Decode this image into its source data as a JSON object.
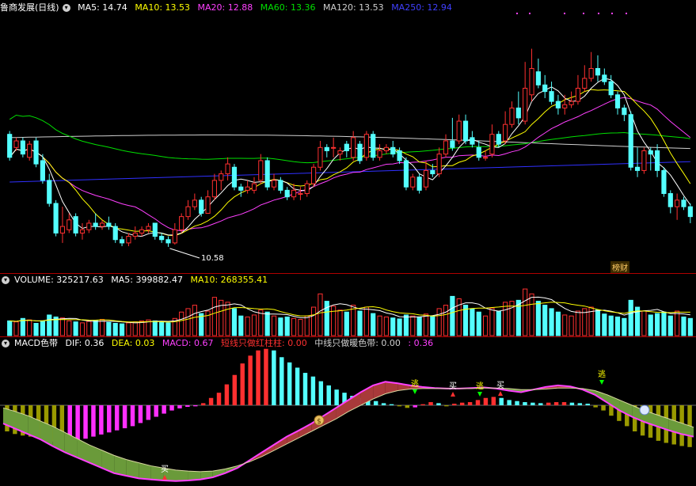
{
  "colors": {
    "up": "#ff3030",
    "down": "#54ffff",
    "ma5": "#ffffff",
    "ma10": "#ffff00",
    "ma20": "#ff40ff",
    "ma60": "#00e000",
    "ma120": "#d0d0d0",
    "ma250": "#3030ff",
    "bg": "#000000",
    "sep": "#b00000"
  },
  "price_panel": {
    "title": "鲁商发展(日线)",
    "collapse_icon": "chevron-down-icon",
    "ma5": "MA5: 14.74",
    "ma10": "MA10: 13.53",
    "ma20": "MA20: 12.88",
    "ma60": "MA60: 13.36",
    "ma120": "MA120: 13.53",
    "ma250": "MA250: 12.94",
    "min_label": "10.58",
    "badge": "榜财"
  },
  "volume_panel": {
    "volume": "VOLUME: 325217.63",
    "ma5": "MA5: 399882.47",
    "ma10": "MA10: 268355.41"
  },
  "macd_panel": {
    "title": "MACD色带",
    "dif": "DIF: 0.36",
    "dea": "DEA: 0.03",
    "macd": "MACD: 0.67",
    "red_bar": "短线只做红柱柱: 0.00",
    "warm_band": "中线只做暖色带: 0.00",
    "extra": ": 0.36",
    "signal_buy": "买",
    "signal_escape": "逃",
    "dollar": "$"
  },
  "chart_data": {
    "type": "candlestick",
    "ylim": [
      10.0,
      17.6
    ],
    "candles": [
      [
        14.0,
        13.3,
        14.1,
        13.2
      ],
      [
        13.6,
        13.8,
        13.9,
        13.5
      ],
      [
        13.8,
        13.4,
        13.9,
        13.3
      ],
      [
        13.3,
        13.7,
        13.8,
        13.2
      ],
      [
        13.8,
        13.1,
        13.9,
        13.0
      ],
      [
        13.2,
        12.6,
        13.4,
        12.5
      ],
      [
        12.6,
        11.9,
        12.8,
        11.8
      ],
      [
        11.9,
        11.0,
        12.0,
        10.9
      ],
      [
        11.0,
        11.2,
        11.8,
        10.7
      ],
      [
        11.1,
        11.4,
        11.6,
        11.0
      ],
      [
        11.5,
        11.0,
        11.6,
        10.9
      ],
      [
        11.0,
        11.1,
        11.3,
        10.8
      ],
      [
        11.1,
        11.3,
        11.4,
        11.0
      ],
      [
        11.3,
        11.2,
        11.6,
        11.1
      ],
      [
        11.2,
        11.3,
        11.4,
        11.1
      ],
      [
        11.3,
        11.2,
        11.5,
        11.1
      ],
      [
        11.2,
        10.8,
        11.3,
        10.7
      ],
      [
        10.8,
        10.7,
        10.9,
        10.6
      ],
      [
        10.7,
        10.9,
        11.0,
        10.6
      ],
      [
        10.9,
        11.0,
        11.2,
        10.8
      ],
      [
        11.0,
        11.1,
        11.2,
        10.9
      ],
      [
        11.1,
        11.2,
        11.3,
        11.0
      ],
      [
        11.3,
        10.9,
        11.3,
        10.8
      ],
      [
        10.9,
        10.8,
        11.0,
        10.7
      ],
      [
        10.8,
        10.7,
        10.9,
        10.58
      ],
      [
        10.7,
        11.1,
        11.3,
        10.65
      ],
      [
        11.1,
        11.5,
        11.6,
        11.0
      ],
      [
        11.5,
        11.8,
        12.0,
        11.4
      ],
      [
        11.8,
        12.0,
        12.2,
        11.7
      ],
      [
        12.0,
        11.6,
        12.1,
        11.5
      ],
      [
        11.6,
        12.1,
        12.3,
        11.6
      ],
      [
        12.1,
        12.6,
        12.8,
        12.0
      ],
      [
        12.6,
        12.8,
        12.9,
        12.3
      ],
      [
        12.8,
        13.1,
        13.3,
        12.6
      ],
      [
        13.0,
        12.4,
        13.1,
        12.3
      ],
      [
        12.4,
        12.3,
        12.5,
        12.1
      ],
      [
        12.3,
        12.4,
        12.6,
        12.2
      ],
      [
        12.3,
        12.5,
        12.7,
        12.2
      ],
      [
        12.6,
        13.2,
        13.4,
        12.5
      ],
      [
        13.2,
        12.4,
        13.3,
        12.3
      ],
      [
        12.4,
        12.6,
        12.8,
        12.3
      ],
      [
        12.6,
        12.3,
        12.7,
        12.2
      ],
      [
        12.3,
        12.1,
        12.4,
        12.0
      ],
      [
        12.1,
        12.3,
        12.5,
        12.0
      ],
      [
        12.2,
        12.2,
        12.4,
        12.0
      ],
      [
        12.2,
        12.5,
        12.6,
        12.1
      ],
      [
        12.5,
        13.0,
        13.1,
        12.4
      ],
      [
        13.0,
        13.6,
        13.8,
        12.9
      ],
      [
        13.6,
        13.5,
        13.7,
        13.3
      ],
      [
        13.6,
        13.6,
        13.9,
        13.3
      ],
      [
        13.4,
        13.5,
        13.6,
        13.2
      ],
      [
        13.7,
        13.5,
        13.8,
        13.3
      ],
      [
        13.3,
        13.9,
        14.1,
        13.2
      ],
      [
        13.7,
        13.2,
        13.8,
        13.1
      ],
      [
        13.3,
        14.0,
        14.1,
        13.2
      ],
      [
        14.0,
        13.3,
        14.1,
        13.2
      ],
      [
        13.3,
        13.5,
        13.7,
        13.2
      ],
      [
        13.5,
        13.6,
        13.7,
        13.4
      ],
      [
        13.6,
        13.4,
        13.8,
        13.3
      ],
      [
        13.5,
        13.2,
        13.6,
        13.1
      ],
      [
        13.2,
        12.4,
        13.3,
        12.3
      ],
      [
        12.4,
        12.7,
        12.8,
        12.3
      ],
      [
        12.7,
        12.3,
        12.8,
        12.2
      ],
      [
        12.4,
        12.9,
        13.2,
        12.3
      ],
      [
        12.9,
        12.8,
        13.1,
        12.7
      ],
      [
        12.8,
        13.4,
        13.6,
        12.7
      ],
      [
        13.4,
        13.8,
        14.0,
        13.3
      ],
      [
        13.8,
        13.6,
        14.5,
        13.5
      ],
      [
        13.8,
        14.4,
        14.6,
        13.7
      ],
      [
        14.4,
        13.8,
        14.6,
        13.7
      ],
      [
        13.9,
        13.7,
        14.1,
        13.6
      ],
      [
        13.6,
        13.3,
        13.8,
        13.2
      ],
      [
        13.3,
        13.3,
        13.5,
        13.2
      ],
      [
        13.4,
        14.0,
        14.3,
        13.3
      ],
      [
        14.0,
        13.7,
        14.1,
        13.6
      ],
      [
        13.8,
        14.3,
        14.7,
        13.7
      ],
      [
        14.3,
        14.8,
        15.0,
        14.2
      ],
      [
        14.8,
        14.5,
        15.3,
        14.3
      ],
      [
        14.4,
        15.4,
        16.2,
        14.3
      ],
      [
        15.2,
        16.0,
        16.6,
        15.0
      ],
      [
        15.9,
        15.5,
        16.3,
        15.4
      ],
      [
        15.5,
        15.3,
        15.8,
        15.1
      ],
      [
        15.3,
        15.0,
        15.6,
        14.9
      ],
      [
        15.0,
        14.8,
        15.2,
        14.6
      ],
      [
        14.8,
        14.9,
        15.2,
        14.6
      ],
      [
        14.9,
        15.0,
        15.3,
        14.8
      ],
      [
        15.0,
        15.4,
        15.8,
        14.9
      ],
      [
        15.4,
        15.7,
        16.1,
        15.3
      ],
      [
        15.7,
        16.0,
        16.5,
        15.6
      ],
      [
        16.0,
        15.8,
        16.4,
        15.6
      ],
      [
        15.8,
        15.6,
        16.0,
        15.5
      ],
      [
        15.6,
        15.2,
        15.8,
        15.1
      ],
      [
        15.2,
        14.8,
        15.3,
        14.6
      ],
      [
        14.8,
        14.6,
        14.9,
        14.4
      ],
      [
        14.6,
        13.0,
        14.7,
        12.9
      ],
      [
        13.0,
        12.9,
        13.6,
        12.7
      ],
      [
        12.9,
        13.5,
        13.6,
        12.8
      ],
      [
        13.5,
        13.4,
        13.6,
        12.9
      ],
      [
        13.5,
        12.9,
        13.7,
        12.7
      ],
      [
        12.9,
        12.2,
        13.0,
        12.1
      ],
      [
        12.2,
        11.8,
        12.3,
        11.6
      ],
      [
        11.8,
        12.0,
        12.2,
        11.4
      ],
      [
        12.0,
        11.8,
        12.1,
        11.7
      ],
      [
        11.8,
        11.5,
        11.9,
        11.3
      ]
    ],
    "volume": [
      0.3,
      0.28,
      0.35,
      0.32,
      0.25,
      0.3,
      0.42,
      0.38,
      0.36,
      0.3,
      0.28,
      0.26,
      0.29,
      0.31,
      0.33,
      0.27,
      0.25,
      0.24,
      0.26,
      0.28,
      0.3,
      0.32,
      0.3,
      0.27,
      0.26,
      0.35,
      0.48,
      0.55,
      0.62,
      0.45,
      0.5,
      0.78,
      0.72,
      0.68,
      0.55,
      0.4,
      0.38,
      0.42,
      0.52,
      0.48,
      0.4,
      0.36,
      0.38,
      0.35,
      0.33,
      0.4,
      0.58,
      0.85,
      0.7,
      0.6,
      0.52,
      0.48,
      0.62,
      0.5,
      0.58,
      0.45,
      0.4,
      0.38,
      0.36,
      0.34,
      0.42,
      0.4,
      0.38,
      0.44,
      0.4,
      0.55,
      0.62,
      0.8,
      0.75,
      0.62,
      0.55,
      0.48,
      0.4,
      0.56,
      0.5,
      0.68,
      0.7,
      0.72,
      0.95,
      0.85,
      0.7,
      0.62,
      0.55,
      0.48,
      0.42,
      0.4,
      0.5,
      0.55,
      0.58,
      0.52,
      0.44,
      0.4,
      0.38,
      0.35,
      0.72,
      0.58,
      0.5,
      0.42,
      0.45,
      0.48,
      0.4,
      0.5,
      0.38,
      0.35
    ],
    "macd": [
      -0.5,
      -0.55,
      -0.58,
      -0.6,
      -0.62,
      -0.66,
      -0.7,
      -0.76,
      -0.72,
      -0.68,
      -0.64,
      -0.6,
      -0.56,
      -0.52,
      -0.48,
      -0.44,
      -0.4,
      -0.34,
      -0.28,
      -0.22,
      -0.16,
      -0.1,
      -0.06,
      -0.03,
      -0.02,
      0.04,
      0.14,
      0.24,
      0.4,
      0.58,
      0.8,
      0.95,
      1.05,
      1.08,
      1.05,
      0.92,
      0.82,
      0.72,
      0.62,
      0.55,
      0.46,
      0.38,
      0.3,
      0.24,
      0.18,
      0.14,
      0.1,
      0.08,
      0.04,
      0.02,
      -0.02,
      -0.05,
      -0.04,
      0.02,
      0.06,
      0.04,
      -0.02,
      0.03,
      0.05,
      0.06,
      0.1,
      0.14,
      0.16,
      0.14,
      0.1,
      0.08,
      0.06,
      0.05,
      0.04,
      0.05,
      0.06,
      0.06,
      0.05,
      0.04,
      0.03,
      -0.04,
      -0.1,
      -0.2,
      -0.3,
      -0.4,
      -0.5,
      -0.58,
      -0.62,
      -0.68,
      -0.72,
      -0.75,
      -0.78,
      -0.8
    ],
    "dif": [
      -0.35,
      -0.45,
      -0.55,
      -0.65,
      -0.78,
      -0.9,
      -1.0,
      -1.1,
      -1.2,
      -1.3,
      -1.35,
      -1.4,
      -1.42,
      -1.44,
      -1.45,
      -1.44,
      -1.42,
      -1.38,
      -1.3,
      -1.2,
      -1.05,
      -0.9,
      -0.75,
      -0.6,
      -0.48,
      -0.35,
      -0.2,
      -0.05,
      0.1,
      0.25,
      0.38,
      0.45,
      0.42,
      0.38,
      0.35,
      0.33,
      0.32,
      0.32,
      0.33,
      0.34,
      0.32,
      0.28,
      0.25,
      0.3,
      0.35,
      0.38,
      0.36,
      0.3,
      0.2,
      0.05,
      -0.1,
      -0.22,
      -0.32,
      -0.4,
      -0.48,
      -0.55,
      -0.6
    ],
    "dea": [
      -0.05,
      -0.12,
      -0.2,
      -0.3,
      -0.4,
      -0.52,
      -0.64,
      -0.76,
      -0.86,
      -0.96,
      -1.04,
      -1.1,
      -1.16,
      -1.2,
      -1.24,
      -1.26,
      -1.27,
      -1.26,
      -1.22,
      -1.16,
      -1.08,
      -0.98,
      -0.86,
      -0.74,
      -0.62,
      -0.5,
      -0.38,
      -0.26,
      -0.12,
      0.0,
      0.12,
      0.22,
      0.28,
      0.31,
      0.32,
      0.32,
      0.32,
      0.32,
      0.32,
      0.33,
      0.33,
      0.32,
      0.3,
      0.3,
      0.31,
      0.33,
      0.33,
      0.32,
      0.28,
      0.2,
      0.1,
      0.0,
      -0.1,
      -0.18,
      -0.26,
      -0.34,
      -0.42
    ]
  }
}
